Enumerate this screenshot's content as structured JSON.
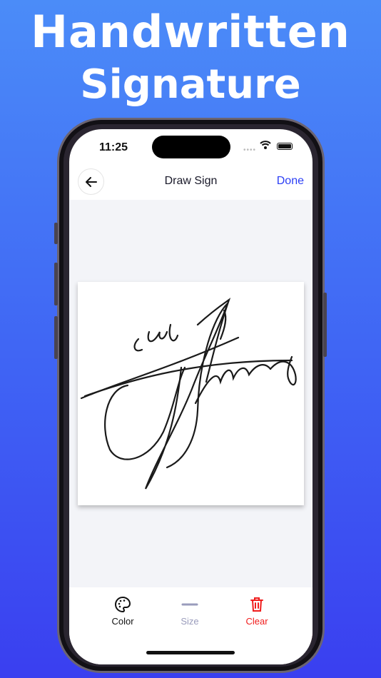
{
  "headline": {
    "line1": "Handwritten",
    "line2": "Signature"
  },
  "status_bar": {
    "time": "11:25",
    "icons": [
      "signal-dots-icon",
      "wifi-icon",
      "battery-icon"
    ]
  },
  "nav": {
    "back_icon": "arrow-left-icon",
    "title": "Draw Sign",
    "done_label": "Done"
  },
  "colors": {
    "accent": "#2b3ef5",
    "clear": "#f01c1c",
    "size_gray": "#9a9cbc"
  },
  "swatches": [
    {
      "color": "#000000",
      "selected": true
    },
    {
      "color": "#f7f7f7",
      "selected": false
    },
    {
      "color": "#f44336",
      "selected": false
    },
    {
      "color": "#ffe8ec",
      "selected": false
    },
    {
      "color": "#ffcbd0",
      "selected": false
    },
    {
      "color": "#ea9a9a",
      "selected": false
    },
    {
      "color": "#e57373",
      "selected": false
    }
  ],
  "toolbar": {
    "color_label": "Color",
    "size_label": "Size",
    "clear_label": "Clear"
  }
}
